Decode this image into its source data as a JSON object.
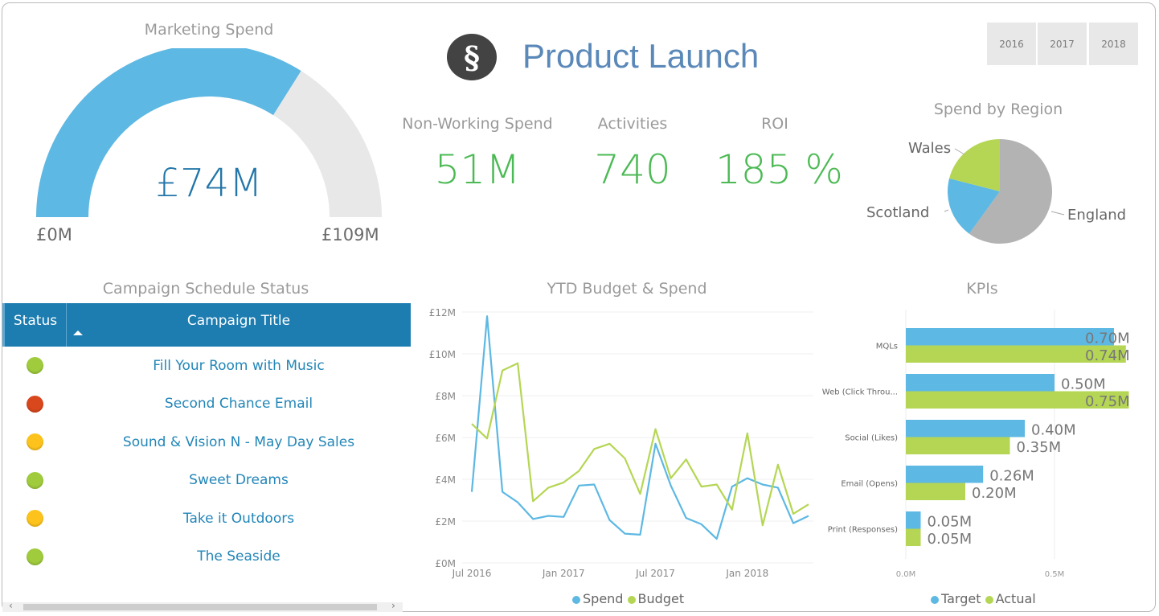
{
  "header": {
    "title": "Product Launch",
    "logo_icon": "section-sign-icon",
    "logo_glyph": "§"
  },
  "year_slicer": {
    "options": [
      "2016",
      "2017",
      "2018"
    ]
  },
  "colors": {
    "blue": "#5db8e3",
    "green": "#b5d654",
    "gray": "#b3b3b3",
    "track": "#e8e8e8",
    "kpi_green": "#4cba54",
    "table_header": "#1d7cb0",
    "link_blue": "#2286b8",
    "status_green": "#9fcb3c",
    "status_red": "#d9471d",
    "status_yellow": "#fdc31c"
  },
  "gauge": {
    "title": "Marketing Spend",
    "value_label": "£74M",
    "min_label": "£0M",
    "max_label": "£109M",
    "value": 74,
    "min": 0,
    "max": 109
  },
  "kpis": [
    {
      "label": "Non-Working Spend",
      "value": "51M"
    },
    {
      "label": "Activities",
      "value": "740"
    },
    {
      "label": "ROI",
      "value": "185 %"
    }
  ],
  "campaign_table": {
    "title": "Campaign Schedule Status",
    "columns": [
      "Status",
      "Campaign Title"
    ],
    "sort": "ascending",
    "rows": [
      {
        "status": "green",
        "title": "Fill Your Room with Music"
      },
      {
        "status": "red",
        "title": "Second Chance Email"
      },
      {
        "status": "yellow",
        "title": "Sound & Vision N - May Day Sales"
      },
      {
        "status": "green",
        "title": "Sweet Dreams"
      },
      {
        "status": "yellow",
        "title": "Take it Outdoors"
      },
      {
        "status": "green",
        "title": "The Seaside"
      }
    ],
    "scroll_left": "‹",
    "scroll_right": "›"
  },
  "chart_data": [
    {
      "id": "spend-by-region",
      "type": "pie",
      "title": "Spend by Region",
      "categories": [
        "England",
        "Scotland",
        "Wales"
      ],
      "values": [
        60,
        19,
        21
      ],
      "colors": [
        "#b3b3b3",
        "#5db8e3",
        "#b5d654"
      ]
    },
    {
      "id": "ytd-budget-spend",
      "type": "line",
      "title": "YTD Budget & Spend",
      "xlabel": "",
      "ylabel": "",
      "ylim": [
        0,
        12
      ],
      "y_ticks": [
        "£0M",
        "£2M",
        "£4M",
        "£6M",
        "£8M",
        "£10M",
        "£12M"
      ],
      "x_ticks": [
        {
          "label": "Jul 2016",
          "index": 0
        },
        {
          "label": "Jan 2017",
          "index": 6
        },
        {
          "label": "Jul 2017",
          "index": 12
        },
        {
          "label": "Jan 2018",
          "index": 18
        }
      ],
      "x": [
        "Jul 2016",
        "Aug 2016",
        "Sep 2016",
        "Oct 2016",
        "Nov 2016",
        "Dec 2016",
        "Jan 2017",
        "Feb 2017",
        "Mar 2017",
        "Apr 2017",
        "May 2017",
        "Jun 2017",
        "Jul 2017",
        "Aug 2017",
        "Sep 2017",
        "Oct 2017",
        "Nov 2017",
        "Dec 2017",
        "Jan 2018",
        "Feb 2018",
        "Mar 2018",
        "Apr 2018",
        "May 2018"
      ],
      "series": [
        {
          "name": "Spend",
          "color": "#5db8e3",
          "values": [
            3.4,
            11.8,
            3.4,
            2.9,
            2.1,
            2.25,
            2.2,
            3.7,
            3.75,
            2.05,
            1.4,
            1.35,
            5.7,
            3.7,
            2.15,
            1.85,
            1.15,
            3.65,
            4.05,
            3.75,
            3.6,
            1.9,
            2.25
          ]
        },
        {
          "name": "Budget",
          "color": "#b5d654",
          "values": [
            6.65,
            5.95,
            9.2,
            9.55,
            2.95,
            3.6,
            3.85,
            4.4,
            5.45,
            5.7,
            5.0,
            3.3,
            6.4,
            4.05,
            4.95,
            3.65,
            3.75,
            2.55,
            6.2,
            1.8,
            4.7,
            2.35,
            2.8
          ]
        }
      ],
      "legend": [
        "Spend",
        "Budget"
      ],
      "legend_position": "bottom",
      "grid": true
    },
    {
      "id": "kpis",
      "type": "bar",
      "orientation": "horizontal",
      "title": "KPIs",
      "categories": [
        "MQLs",
        "Web (Click Throu...",
        "Social (Likes)",
        "Email (Opens)",
        "Print (Responses)"
      ],
      "series": [
        {
          "name": "Target",
          "color": "#5db8e3",
          "values": [
            0.7,
            0.5,
            0.4,
            0.26,
            0.05
          ],
          "labels": [
            "0.70M",
            "0.50M",
            "0.40M",
            "0.26M",
            "0.05M"
          ]
        },
        {
          "name": "Actual",
          "color": "#b5d654",
          "values": [
            0.74,
            0.75,
            0.35,
            0.2,
            0.05
          ],
          "labels": [
            "0.74M",
            "0.75M",
            "0.35M",
            "0.20M",
            "0.05M"
          ]
        }
      ],
      "xlim": [
        0,
        0.8
      ],
      "x_ticks": [
        "0.0M",
        "0.5M"
      ],
      "x_tick_values": [
        0,
        0.5
      ],
      "legend": [
        "Target",
        "Actual"
      ],
      "legend_position": "bottom"
    }
  ]
}
